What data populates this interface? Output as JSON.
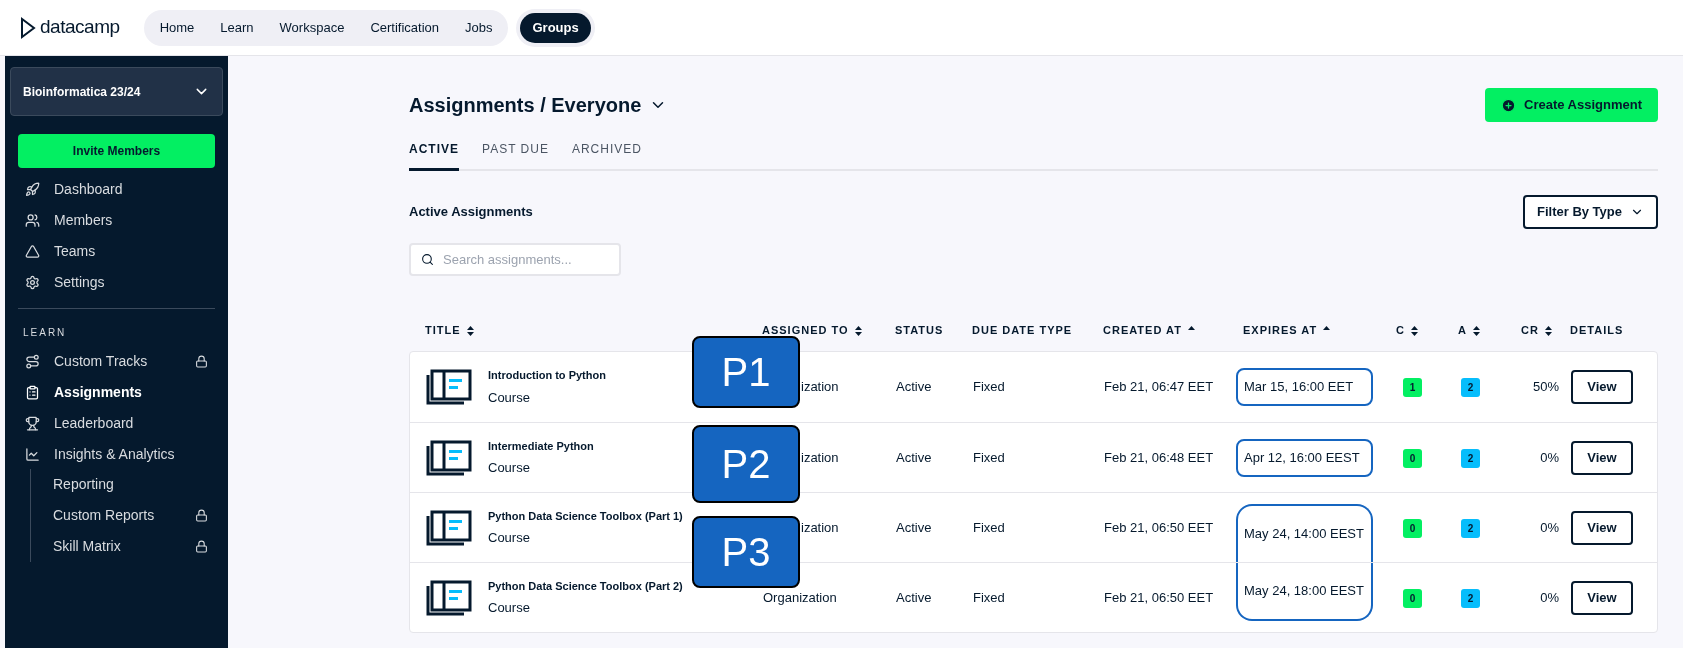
{
  "top_nav": {
    "logo": "datacamp",
    "links": [
      {
        "label": "Home",
        "selected": false
      },
      {
        "label": "Learn",
        "selected": false
      },
      {
        "label": "Workspace",
        "selected": false
      },
      {
        "label": "Certification",
        "selected": false
      },
      {
        "label": "Jobs",
        "selected": false
      }
    ],
    "group_button": {
      "label": "Groups",
      "selected": true
    }
  },
  "sidebar": {
    "group_select": "Bioinformatica 23/24",
    "invite_button": "Invite Members",
    "items": [
      {
        "label": "Dashboard",
        "selected": false
      },
      {
        "label": "Members",
        "selected": false
      },
      {
        "label": "Teams",
        "selected": false
      },
      {
        "label": "Settings",
        "selected": false
      }
    ],
    "section_label": "LEARN",
    "learn_items": [
      {
        "label": "Custom Tracks",
        "selected": false,
        "locked": true
      },
      {
        "label": "Assignments",
        "selected": true,
        "locked": false
      },
      {
        "label": "Leaderboard",
        "selected": false,
        "locked": false
      },
      {
        "label": "Insights & Analytics",
        "selected": false,
        "locked": false,
        "children": [
          {
            "label": "Reporting",
            "locked": false
          },
          {
            "label": "Custom Reports",
            "locked": true
          },
          {
            "label": "Skill Matrix",
            "locked": true
          }
        ]
      }
    ]
  },
  "page": {
    "title": "Assignments / Everyone",
    "create_button": "Create Assignment",
    "tabs": [
      {
        "label": "ACTIVE",
        "selected": true
      },
      {
        "label": "PAST DUE",
        "selected": false
      },
      {
        "label": "ARCHIVED",
        "selected": false
      }
    ],
    "section_title": "Active Assignments",
    "filter_button": "Filter By Type",
    "search": {
      "placeholder": "Search assignments..."
    }
  },
  "table": {
    "columns": [
      {
        "label": "TITLE",
        "kind": "sortable"
      },
      {
        "label": "ASSIGNED TO",
        "kind": "sortable"
      },
      {
        "label": "STATUS",
        "kind": "plain"
      },
      {
        "label": "DUE DATE TYPE",
        "kind": "plain"
      },
      {
        "label": "CREATED AT",
        "kind": "ascending"
      },
      {
        "label": "EXPIRES AT",
        "kind": "ascending"
      },
      {
        "label": "C",
        "kind": "sortable"
      },
      {
        "label": "A",
        "kind": "sortable"
      },
      {
        "label": "CR",
        "kind": "sortable"
      },
      {
        "label": "DETAILS",
        "kind": "plain"
      }
    ],
    "rows": [
      {
        "title": "Introduction to Python",
        "type": "Course",
        "assigned_to": "ization",
        "status": "Active",
        "due_date_type": "Fixed",
        "created_at": "Feb 21, 06:47 EET",
        "expires_at": "Mar 15, 16:00 EET",
        "kind": "boxed",
        "c": "1",
        "a": "2",
        "cr": "50%",
        "action": "View"
      },
      {
        "title": "Intermediate Python",
        "type": "Course",
        "assigned_to": "ization",
        "status": "Active",
        "due_date_type": "Fixed",
        "created_at": "Feb 21, 06:48 EET",
        "expires_at": "Apr 12, 16:00 EEST",
        "kind": "boxed",
        "c": "0",
        "a": "2",
        "cr": "0%",
        "action": "View"
      },
      {
        "title": "Python Data Science Toolbox (Part 1)",
        "type": "Course",
        "assigned_to": "ization",
        "status": "Active",
        "due_date_type": "Fixed",
        "created_at": "Feb 21, 06:50 EET",
        "expires_at": "May 24, 14:00 EEST",
        "kind": "group_start",
        "c": "0",
        "a": "2",
        "cr": "0%",
        "action": "View"
      },
      {
        "title": "Python Data Science Toolbox (Part 2)",
        "type": "Course",
        "assigned_to": "Organization",
        "status": "Active",
        "due_date_type": "Fixed",
        "created_at": "Feb 21, 06:50 EET",
        "expires_at": "May 24, 18:00 EEST",
        "kind": "group_end",
        "c": "0",
        "a": "2",
        "cr": "0%",
        "action": "View"
      }
    ]
  },
  "callouts": [
    {
      "label": "P1"
    },
    {
      "label": "P2"
    },
    {
      "label": "P3"
    }
  ]
}
